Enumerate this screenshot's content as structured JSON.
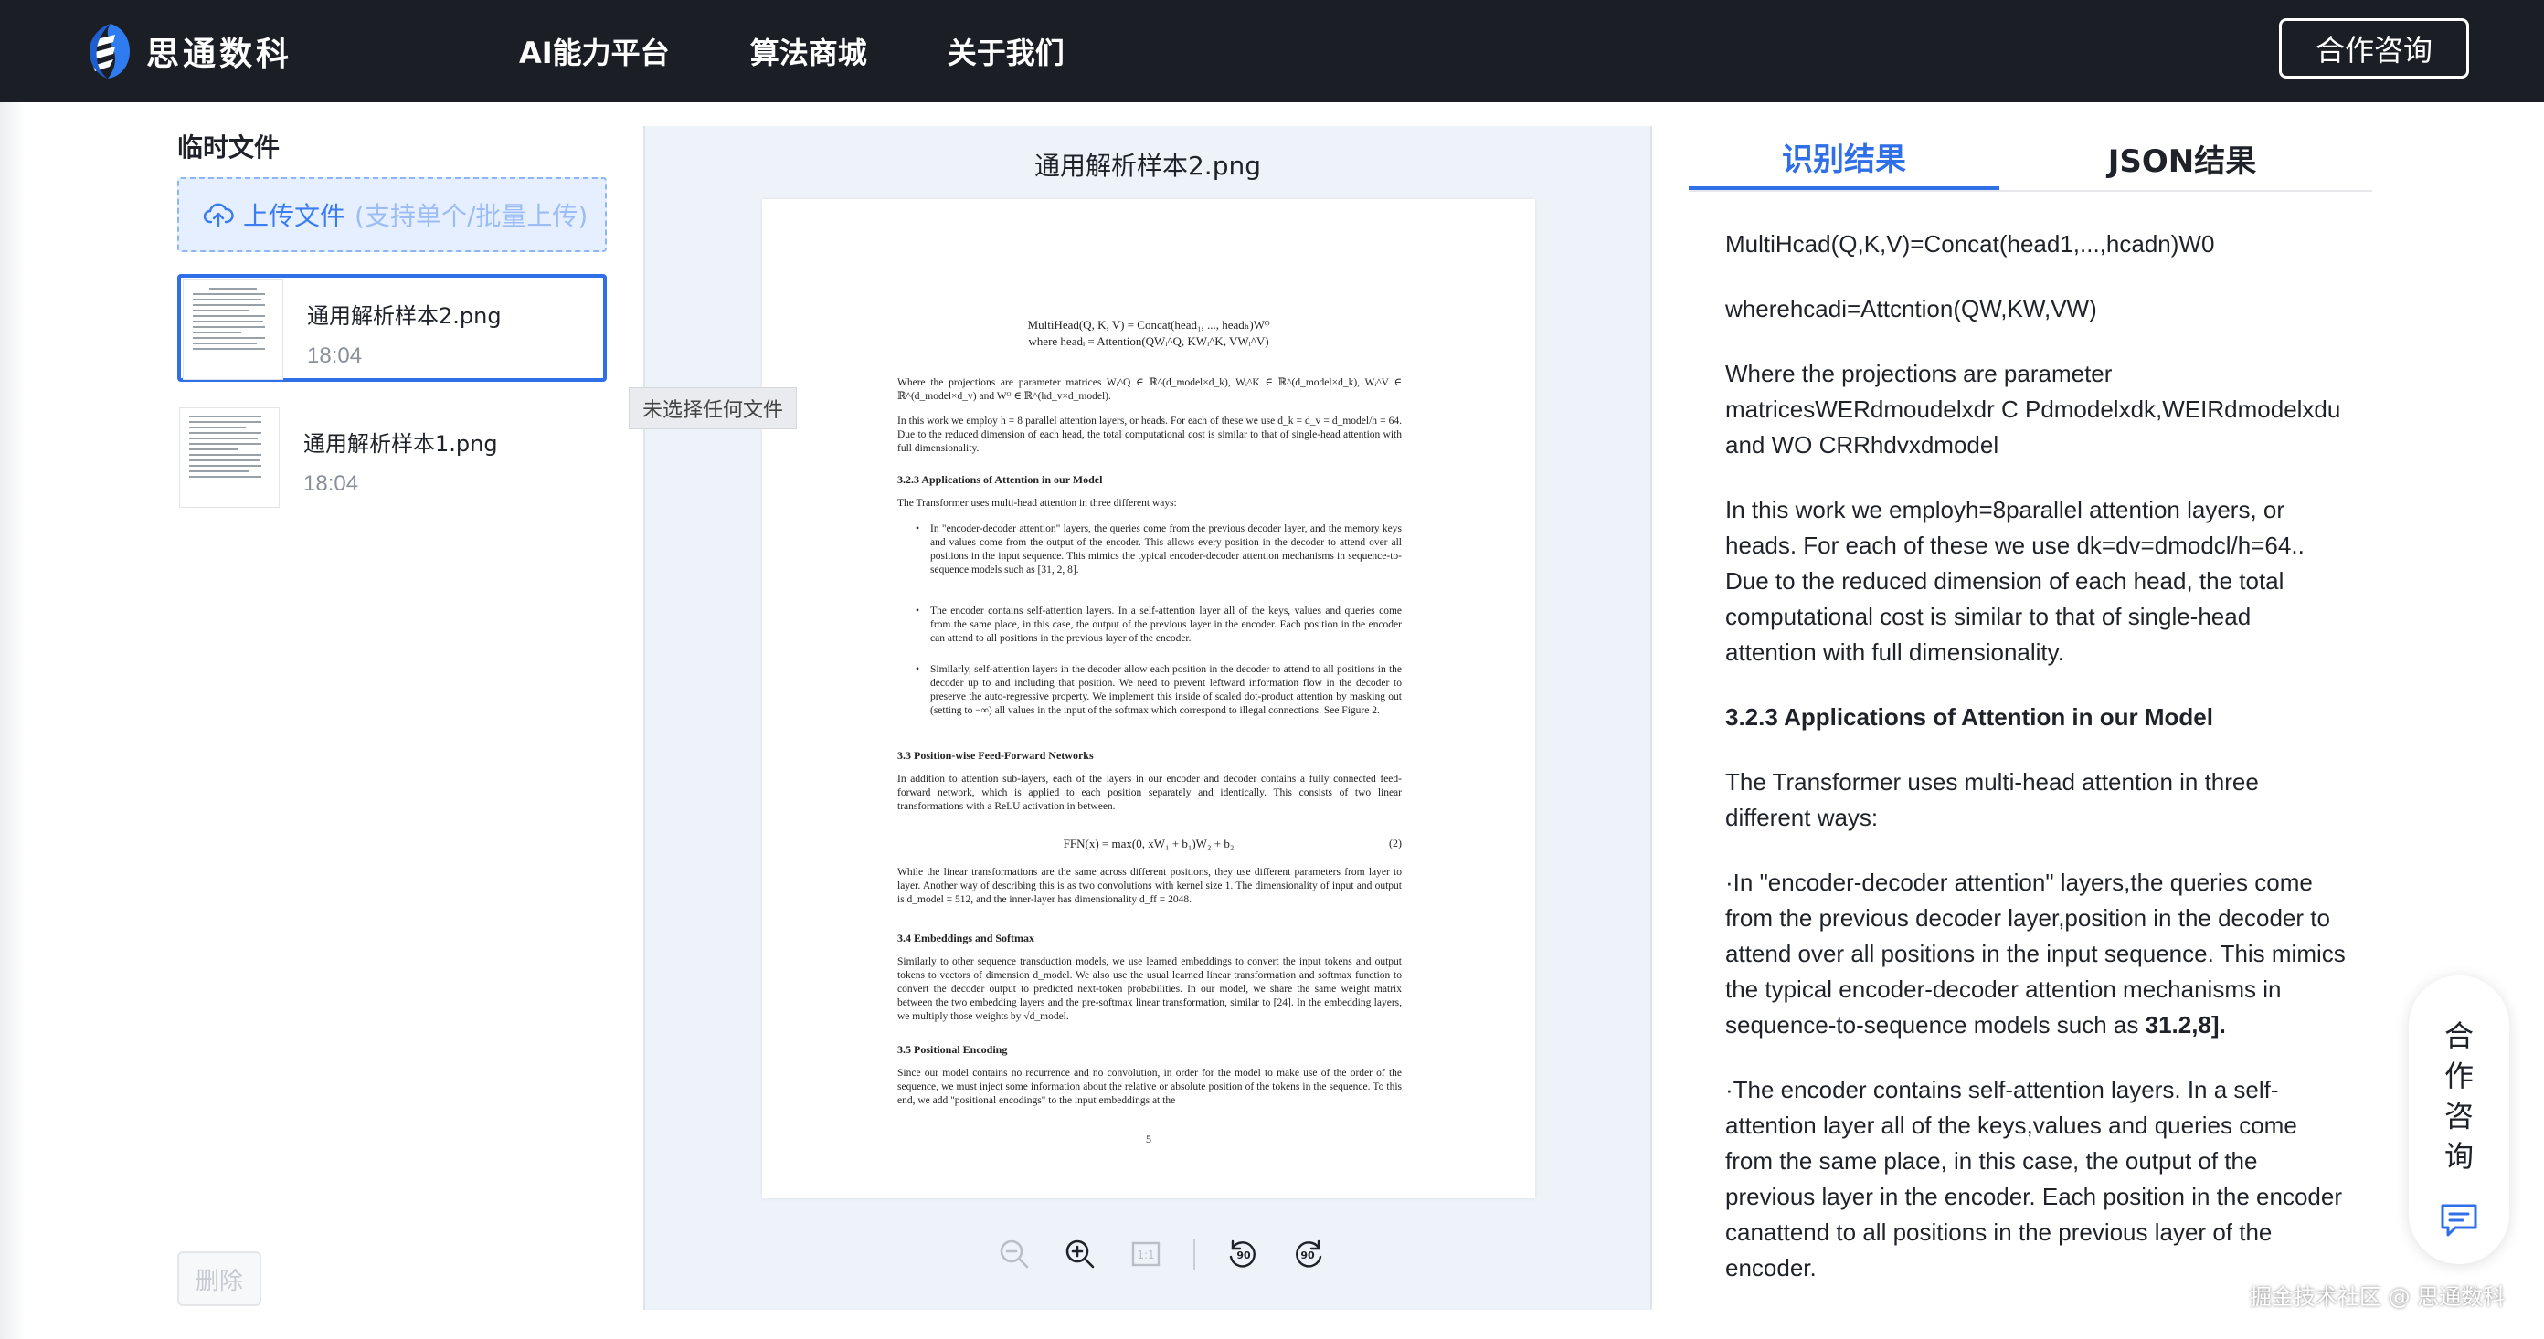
{
  "nav": {
    "brand_name": "思通数科",
    "links": [
      "AI能力平台",
      "算法商城",
      "关于我们"
    ],
    "consult_label": "合作咨询"
  },
  "files": {
    "title": "临时文件",
    "upload_label": "上传文件",
    "upload_hint": "(支持单个/批量上传)",
    "items": [
      {
        "name": "通用解析样本2.png",
        "time": "18:04",
        "selected": true
      },
      {
        "name": "通用解析样本1.png",
        "time": "18:04",
        "selected": false
      }
    ],
    "delete_label": "删除"
  },
  "preview": {
    "title": "通用解析样本2.png",
    "tooltip": "未选择任何文件",
    "page": {
      "eq1": "MultiHead(Q, K, V) = Concat(head₁, ..., headₕ)Wᴼ",
      "eq2": "where headᵢ = Attention(QWᵢ^Q, KWᵢ^K, VWᵢ^V)",
      "p1": "Where the projections are parameter matrices Wᵢ^Q ∈ ℝ^(d_model×d_k), Wᵢ^K ∈ ℝ^(d_model×d_k), Wᵢ^V ∈ ℝ^(d_model×d_v) and Wᴼ ∈ ℝ^(hd_v×d_model).",
      "p2": "In this work we employ h = 8 parallel attention layers, or heads. For each of these we use d_k = d_v = d_model/h = 64. Due to the reduced dimension of each head, the total computational cost is similar to that of single-head attention with full dimensionality.",
      "h1": "3.2.3    Applications of Attention in our Model",
      "p3": "The Transformer uses multi-head attention in three different ways:",
      "b1": "In \"encoder-decoder attention\" layers, the queries come from the previous decoder layer, and the memory keys and values come from the output of the encoder. This allows every position in the decoder to attend over all positions in the input sequence. This mimics the typical encoder-decoder attention mechanisms in sequence-to-sequence models such as [31, 2, 8].",
      "b2": "The encoder contains self-attention layers. In a self-attention layer all of the keys, values and queries come from the same place, in this case, the output of the previous layer in the encoder. Each position in the encoder can attend to all positions in the previous layer of the encoder.",
      "b3": "Similarly, self-attention layers in the decoder allow each position in the decoder to attend to all positions in the decoder up to and including that position. We need to prevent leftward information flow in the decoder to preserve the auto-regressive property. We implement this inside of scaled dot-product attention by masking out (setting to −∞) all values in the input of the softmax which correspond to illegal connections. See Figure 2.",
      "h2": "3.3    Position-wise Feed-Forward Networks",
      "p4": "In addition to attention sub-layers, each of the layers in our encoder and decoder contains a fully connected feed-forward network, which is applied to each position separately and identically. This consists of two linear transformations with a ReLU activation in between.",
      "eq3": "FFN(x) = max(0, xW₁ + b₁)W₂ + b₂",
      "eq3num": "(2)",
      "p5": "While the linear transformations are the same across different positions, they use different parameters from layer to layer. Another way of describing this is as two convolutions with kernel size 1. The dimensionality of input and output is d_model = 512, and the inner-layer has dimensionality d_ff = 2048.",
      "h3": "3.4    Embeddings and Softmax",
      "p6": "Similarly to other sequence transduction models, we use learned embeddings to convert the input tokens and output tokens to vectors of dimension d_model. We also use the usual learned linear transformation and softmax function to convert the decoder output to predicted next-token probabilities. In our model, we share the same weight matrix between the two embedding layers and the pre-softmax linear transformation, similar to [24]. In the embedding layers, we multiply those weights by √d_model.",
      "h4": "3.5    Positional Encoding",
      "p7": "Since our model contains no recurrence and no convolution, in order for the model to make use of the order of the sequence, we must inject some information about the relative or absolute position of the tokens in the sequence. To this end, we add \"positional encodings\" to the input embeddings at the",
      "page_number": "5"
    },
    "toolbar": [
      "zoom-out-icon",
      "zoom-in-icon",
      "actual-size-icon",
      "rotate-left-icon",
      "rotate-right-icon"
    ]
  },
  "results": {
    "tab_active": "识别结果",
    "tab_inactive": "JSON结果",
    "paragraphs": [
      "MultiHcad(Q,K,V)=Concat(head1,...,hcadn)W0",
      "wherehcadi=Attcntion(QW,KW,VW)",
      "Where the projections are parameter matricesWERdmoudelxdr C Pdmodelxdk,WEIRdmodelxdu and WO CRRhdvxdmodel",
      "In this work we employh=8parallel attention layers, or heads. For each of these we use dk=dv=dmodcl/h=64.. Due to the reduced dimension of each head, the total computational cost is similar to that of single-head attention with full dimensionality.",
      "3.2.3 Applications of Attention in our Model",
      "The Transformer uses multi-head attention in three different ways:",
      "·In \"encoder-decoder attention\" layers,the queries come from the previous decoder layer,position in the decoder to attend over all positions in the input sequence. This mimics the typical encoder-decoder attention mechanisms in sequence-to-sequence models such as",
      "31.2,8].",
      "·The encoder contains self-attention layers. In a self-attention layer all of the keys,values and queries come from the same place, in this case, the output of the previous layer in the encoder. Each position in the encoder canattend to all positions in the previous layer of the encoder."
    ]
  },
  "float_consult": {
    "chars": [
      "合",
      "作",
      "咨",
      "询"
    ],
    "icon": "chat-icon"
  },
  "watermark": "掘金技术社区 @ 思通数科",
  "colors": {
    "nav_bg": "#1b1e24",
    "accent": "#2f6fe8",
    "upload_bg": "#e6efff",
    "preview_bg": "#eef2f9"
  }
}
